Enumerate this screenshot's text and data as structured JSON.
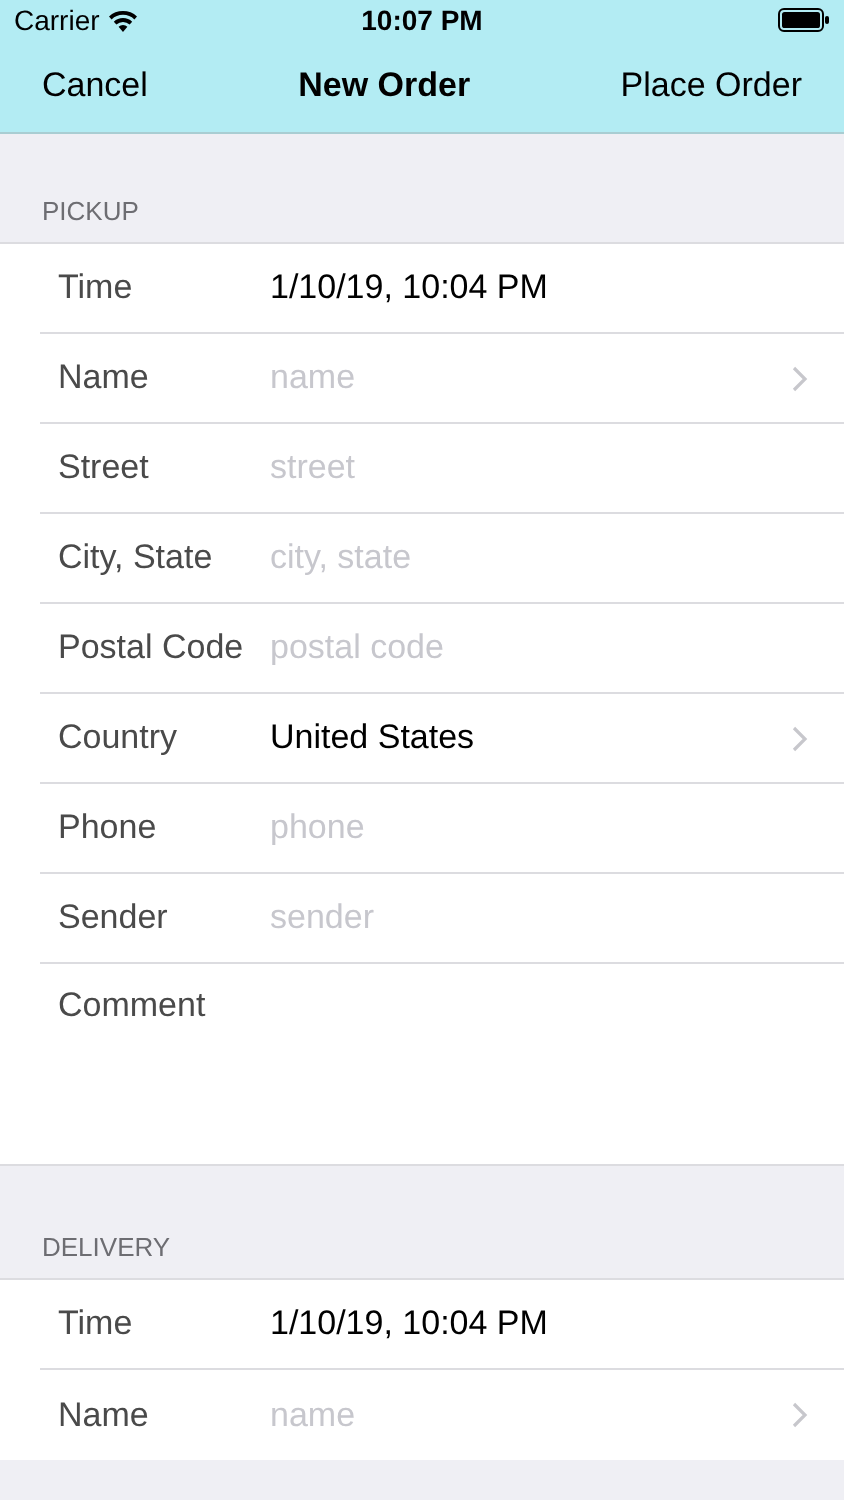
{
  "status_bar": {
    "carrier": "Carrier",
    "time": "10:07 PM"
  },
  "nav": {
    "left": "Cancel",
    "title": "New Order",
    "right": "Place Order"
  },
  "sections": [
    {
      "header": "PICKUP",
      "rows": [
        {
          "kind": "value",
          "label": "Time",
          "value": "1/10/19, 10:04 PM",
          "disclosure": false
        },
        {
          "kind": "field",
          "label": "Name",
          "placeholder": "name",
          "disclosure": true
        },
        {
          "kind": "field",
          "label": "Street",
          "placeholder": "street",
          "disclosure": false
        },
        {
          "kind": "field",
          "label": "City, State",
          "placeholder": "city, state",
          "disclosure": false
        },
        {
          "kind": "field",
          "label": "Postal Code",
          "placeholder": "postal code",
          "disclosure": false
        },
        {
          "kind": "value",
          "label": "Country",
          "value": "United States",
          "disclosure": true
        },
        {
          "kind": "field",
          "label": "Phone",
          "placeholder": "phone",
          "disclosure": false
        },
        {
          "kind": "field",
          "label": "Sender",
          "placeholder": "sender",
          "disclosure": false
        },
        {
          "kind": "textarea",
          "label": "Comment"
        }
      ]
    },
    {
      "header": "DELIVERY",
      "rows": [
        {
          "kind": "value",
          "label": "Time",
          "value": "1/10/19, 10:04 PM",
          "disclosure": false
        },
        {
          "kind": "field",
          "label": "Name",
          "placeholder": "name",
          "disclosure": true
        }
      ]
    }
  ]
}
